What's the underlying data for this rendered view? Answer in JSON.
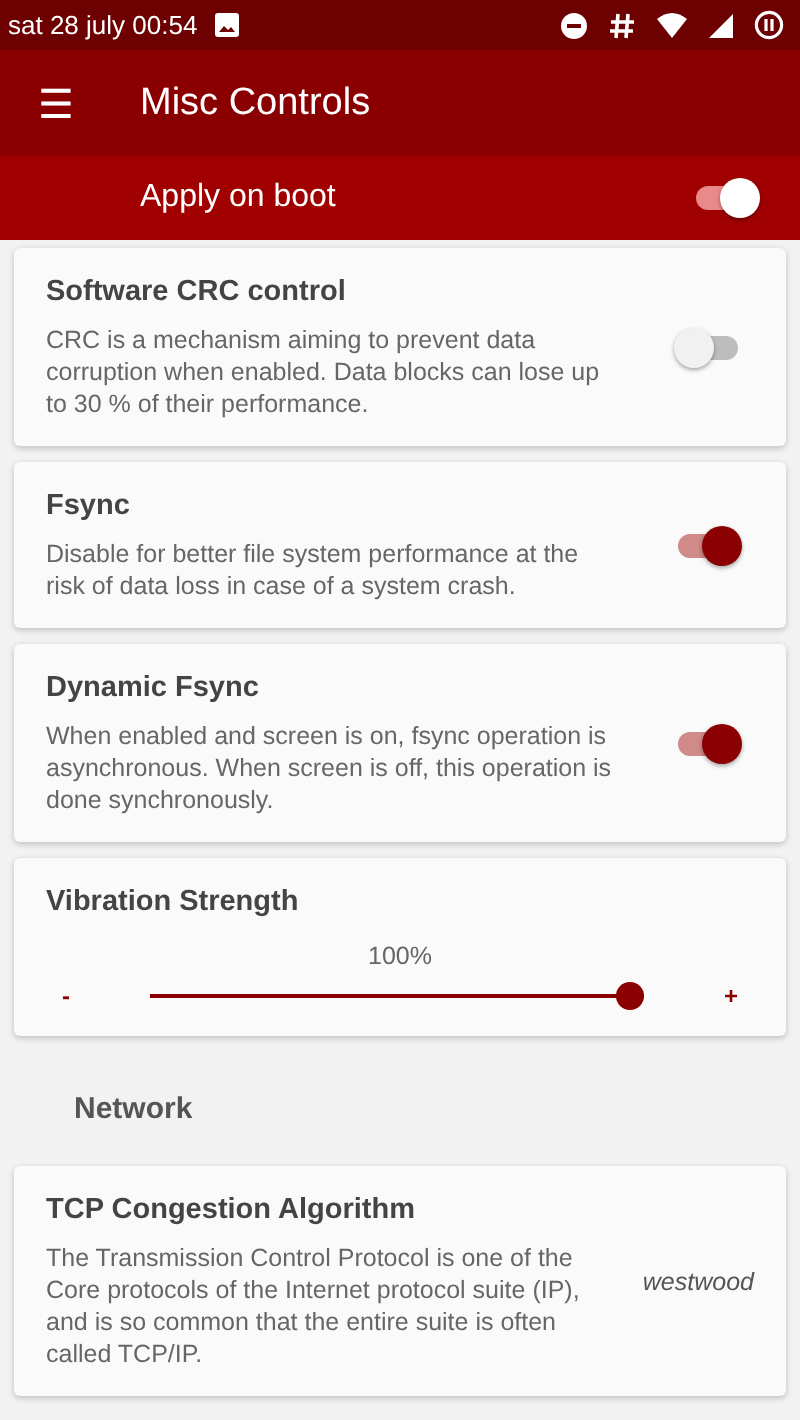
{
  "status_bar": {
    "time": "sat 28 july 00:54"
  },
  "app_bar": {
    "menu_icon": "☰",
    "title": "Misc Controls"
  },
  "apply_on_boot": {
    "label": "Apply on boot",
    "on": true
  },
  "items": [
    {
      "kind": "switch",
      "title": "Software CRC control",
      "description": "CRC is a mechanism aiming to prevent data corruption when enabled. Data blocks can lose up to 30 % of their performance.",
      "on": false
    },
    {
      "kind": "switch",
      "title": "Fsync",
      "description": "Disable for better file system performance at the risk of data loss in case of a system crash.",
      "on": true
    },
    {
      "kind": "switch",
      "title": "Dynamic Fsync",
      "description": "When enabled and screen is on, fsync operation is asynchronous. When screen is off, this operation is done synchronously.",
      "on": true
    },
    {
      "kind": "slider",
      "title": "Vibration Strength",
      "reading": "100%",
      "minus": "-",
      "plus": "+",
      "level": 1.0
    },
    {
      "kind": "header",
      "title": "Network"
    },
    {
      "kind": "value",
      "title": "TCP Congestion Algorithm",
      "description": "The Transmission Control Protocol is one of the Core protocols of the Internet protocol suite (IP), and is so common that the entire suite is often called TCP/IP.",
      "value": "westwood"
    }
  ]
}
